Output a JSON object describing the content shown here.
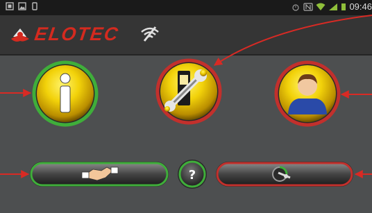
{
  "status_bar": {
    "time": "09:46",
    "icons": [
      "notification-icon",
      "image-icon",
      "phone-icon",
      "alarm-icon",
      "nfc-icon",
      "wifi-icon",
      "signal-icon",
      "battery-icon"
    ]
  },
  "app_bar": {
    "logo_text": "ELOTEC",
    "logo_icon": "elotec-logo-icon",
    "connection_icon": "wifi-off-icon"
  },
  "buttons": {
    "info": {
      "icon": "info-icon",
      "ring_color": "#3fae3a"
    },
    "settings": {
      "icon": "wrench-device-icon",
      "ring_color": "#c2302c"
    },
    "user": {
      "icon": "user-icon",
      "ring_color": "#c2302c"
    },
    "handshake": {
      "icon": "handshake-icon",
      "ring_color": "#3fae3a"
    },
    "help": {
      "label": "?",
      "ring_color": "#3fae3a"
    },
    "connect": {
      "icon": "key-dial-icon",
      "ring_color": "#c2302c"
    }
  },
  "colors": {
    "arrow": "#d92a24",
    "yellow": "#f2d20a",
    "background": "#4d4f50"
  }
}
